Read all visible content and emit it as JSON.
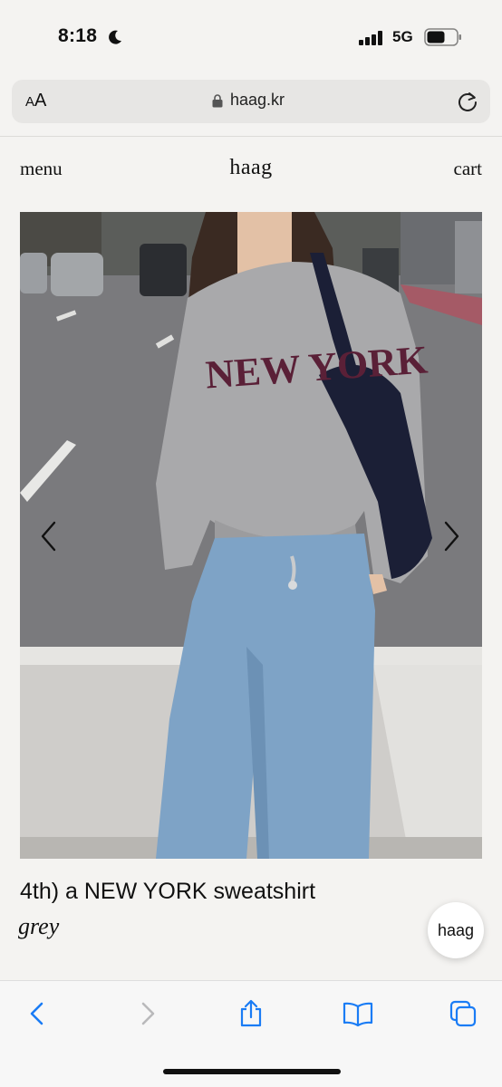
{
  "status_bar": {
    "time": "8:18",
    "network": "5G",
    "icons": [
      "moon-icon",
      "signal-icon",
      "battery-icon"
    ]
  },
  "address_bar": {
    "text_size_label_big": "A",
    "text_size_label_small": "A",
    "url": "haag.kr",
    "icons": [
      "lock-icon",
      "reload-icon"
    ]
  },
  "site_header": {
    "menu_label": "menu",
    "logo": "haag",
    "cart_label": "cart"
  },
  "product": {
    "print_text": "NEW YORK",
    "title": "4th) a NEW YORK sweatshirt",
    "variant": "grey",
    "gallery_icons": [
      "chevron-left-icon",
      "chevron-right-icon"
    ]
  },
  "chat_button": {
    "label": "haag"
  },
  "toolbar": {
    "icons": [
      "back-icon",
      "forward-icon",
      "share-icon",
      "bookmarks-icon",
      "tabs-icon"
    ]
  },
  "colors": {
    "page_bg": "#f4f3f1",
    "accent_blue": "#1a7cf5",
    "sweatshirt": "#a9a9ab",
    "print": "#5a2037",
    "jeans": "#7ea3c6"
  }
}
